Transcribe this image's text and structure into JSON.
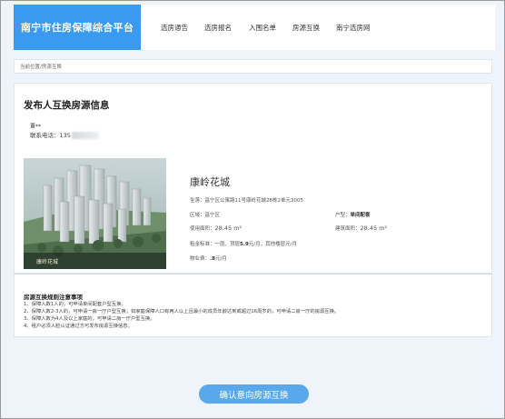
{
  "header": {
    "brand": "南宁市住房保障综合平台",
    "nav": [
      "选房通告",
      "选房报名",
      "入围名单",
      "房源互换",
      "南宁选房网"
    ]
  },
  "breadcrumb": "当前位置/房源互换",
  "page": {
    "title": "发布人互换房源信息",
    "contact_name": "覃**",
    "contact_phone_label": "联系电话：",
    "contact_phone_visible": "135"
  },
  "property": {
    "name": "康岭花城",
    "photo_caption": "康岭花城",
    "address_label": "坐落：",
    "address": "邕宁区公寓路11号康岭花城28栋2单元3005",
    "district_label": "区域：",
    "district": "邕宁区",
    "type_label": "户型：",
    "type": "单间配套",
    "usable_area_label": "使用面积：",
    "usable_area": "28.45 m²",
    "building_area_label": "建筑面积：",
    "building_area": "28.45 m²",
    "rent_label": "租金标准：",
    "rent_text_a": "一层、顶层",
    "rent_value": "5.9",
    "rent_text_b": "元/月，其他楼层元/月",
    "property_fee_label": "物业费：",
    "property_fee_value": ".8",
    "property_fee_unit": "元/月"
  },
  "rules": {
    "title": "房源互换规则注意事项",
    "lines": [
      "1、保障人数1人的，可申请单间配套户型互换。",
      "2、保障人数2-3人的，可申请一房一厅户型互换；如家庭保障人口有两人以上且最小的成员年龄达到或超过16周岁的，可申请二房一厅的房源互换。",
      "3、保障人数为4人及以上家庭的，可申请二房一厅户型互换。",
      "4、租户必须人脸认证通过方可发布房源互换信息。"
    ]
  },
  "confirm_button": "确认意向房源互换"
}
